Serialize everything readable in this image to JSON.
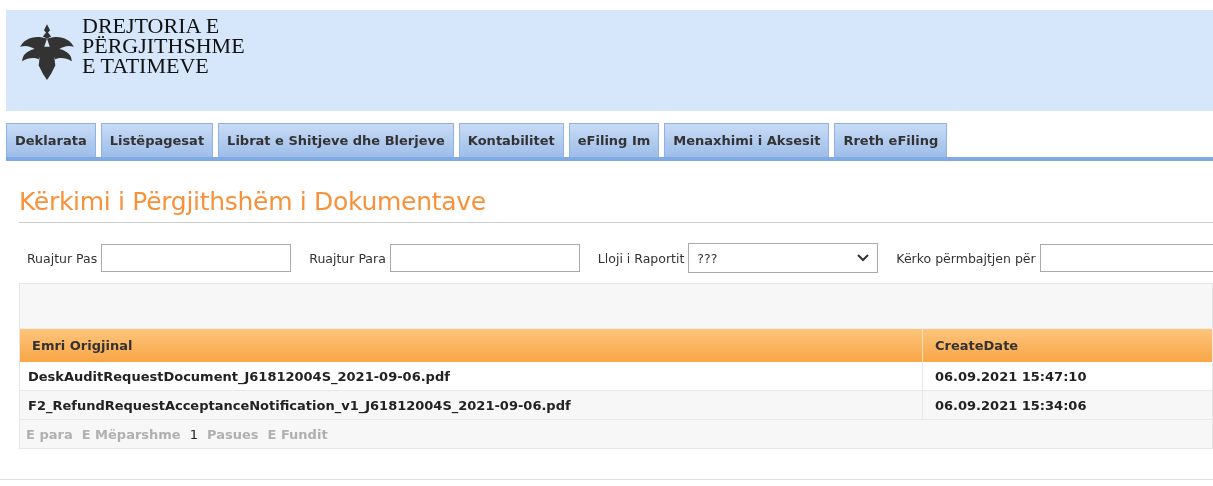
{
  "header": {
    "logo_lines": [
      "DREJTORIA E",
      "PËRGJITHSHME",
      "E TATIMEVE"
    ]
  },
  "tabs": [
    {
      "label": "Deklarata"
    },
    {
      "label": "Listëpagesat"
    },
    {
      "label": "Librat e Shitjeve dhe Blerjeve"
    },
    {
      "label": "Kontabilitet"
    },
    {
      "label": "eFiling Im"
    },
    {
      "label": "Menaxhimi i Aksesit"
    },
    {
      "label": "Rreth eFiling"
    }
  ],
  "page_title": "Kërkimi i Përgjithshëm i Dokumentave",
  "filters": [
    {
      "kind": "text",
      "label": "Ruajtur Pas"
    },
    {
      "kind": "text",
      "label": "Ruajtur Para"
    },
    {
      "kind": "select",
      "label": "Lloji i Raportit",
      "value": "???"
    },
    {
      "kind": "text",
      "label": "Kërko përmbajtjen për"
    }
  ],
  "table": {
    "columns": [
      "Emri Origjinal",
      "CreateDate"
    ],
    "rows": [
      [
        "DeskAuditRequestDocument_J61812004S_2021-09-06.pdf",
        "06.09.2021 15:47:10"
      ],
      [
        "F2_RefundRequestAcceptanceNotification_v1_J61812004S_2021-09-06.pdf",
        "06.09.2021 15:34:06"
      ]
    ]
  },
  "pager": [
    {
      "label": "E para",
      "disabled": true
    },
    {
      "label": "E Mëparshme",
      "disabled": true
    },
    {
      "label": "1",
      "disabled": false
    },
    {
      "label": "Pasues",
      "disabled": true
    },
    {
      "label": "E Fundit",
      "disabled": true
    }
  ]
}
